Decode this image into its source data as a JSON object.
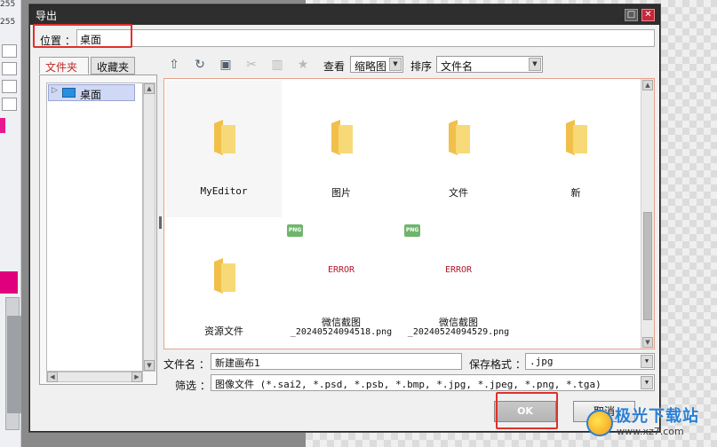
{
  "app": {
    "top_numbers": [
      "255",
      "255"
    ]
  },
  "dialog": {
    "title": "导出",
    "location_label": "位置 ：",
    "location_value": "桌面",
    "tabs": [
      "文件夹",
      "收藏夹"
    ],
    "tree": [
      {
        "label": "桌面",
        "selected": true
      }
    ],
    "toolbar": {
      "icons": [
        "up-folder-icon",
        "refresh-icon",
        "new-folder-icon",
        "cut-icon",
        "delete-icon",
        "star-icon"
      ],
      "view_label": "查看",
      "view_value": "缩略图",
      "sort_label": "排序",
      "sort_value": "文件名"
    },
    "files": [
      {
        "type": "folder",
        "name": "MyEditor"
      },
      {
        "type": "folder",
        "name": "图片"
      },
      {
        "type": "folder",
        "name": "文件"
      },
      {
        "type": "folder",
        "name": "新"
      },
      {
        "type": "folder",
        "name": "资源文件"
      },
      {
        "type": "image",
        "badge": "PNG",
        "preview": "ERROR",
        "name": "微信截图",
        "sub": "_20240524094518.png"
      },
      {
        "type": "image",
        "badge": "PNG",
        "preview": "ERROR",
        "name": "微信截图",
        "sub": "_20240524094529.png"
      }
    ],
    "filename_label": "文件名 ：",
    "filename_value": "新建画布1",
    "format_label": "保存格式 ：",
    "format_value": ".jpg",
    "filter_label": "筛选 ：",
    "filter_value": "图像文件 (*.sai2, *.psd, *.psb, *.bmp, *.jpg, *.jpeg, *.png, *.tga)",
    "ok_label": "OK",
    "cancel_label": "取消"
  },
  "watermark": {
    "main": "极光下载站",
    "sub": "www.xz7.com"
  },
  "colors": {
    "highlight": "#e0302a",
    "titlebar": "#2e2e2e",
    "folder": "#f5d36b",
    "accent_magenta": "#e0007e"
  }
}
